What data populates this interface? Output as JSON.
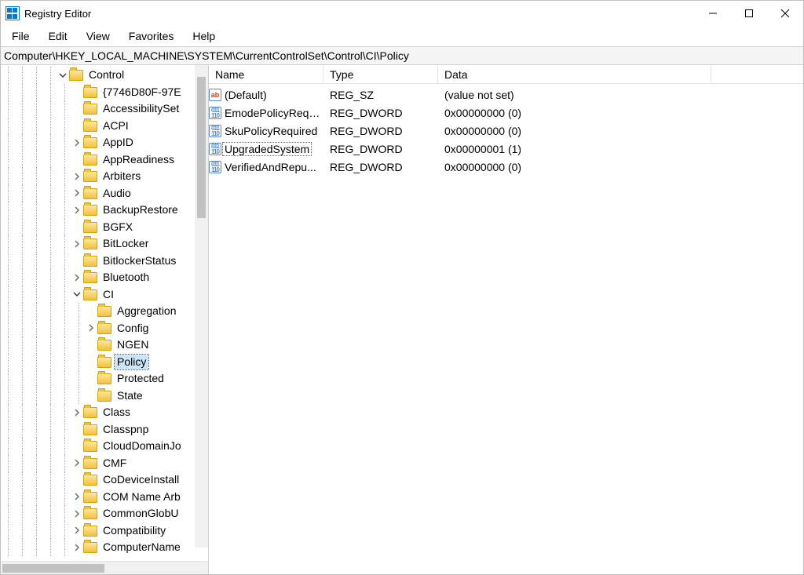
{
  "window": {
    "title": "Registry Editor"
  },
  "menu": {
    "file": "File",
    "edit": "Edit",
    "view": "View",
    "favorites": "Favorites",
    "help": "Help"
  },
  "address": "Computer\\HKEY_LOCAL_MACHINE\\SYSTEM\\CurrentControlSet\\Control\\CI\\Policy",
  "columns": {
    "name": "Name",
    "type": "Type",
    "data": "Data"
  },
  "values": [
    {
      "name": "(Default)",
      "type": "REG_SZ",
      "data": "(value not set)",
      "icon": "str",
      "highlighted": false
    },
    {
      "name": "EmodePolicyRequ...",
      "type": "REG_DWORD",
      "data": "0x00000000 (0)",
      "icon": "bin",
      "highlighted": false
    },
    {
      "name": "SkuPolicyRequired",
      "type": "REG_DWORD",
      "data": "0x00000000 (0)",
      "icon": "bin",
      "highlighted": false
    },
    {
      "name": "UpgradedSystem",
      "type": "REG_DWORD",
      "data": "0x00000001 (1)",
      "icon": "bin",
      "highlighted": true
    },
    {
      "name": "VerifiedAndRepu...",
      "type": "REG_DWORD",
      "data": "0x00000000 (0)",
      "icon": "bin",
      "highlighted": false
    }
  ],
  "tree": [
    {
      "depth": 4,
      "exp": "open",
      "label": "Control",
      "selected": false
    },
    {
      "depth": 5,
      "exp": "none",
      "label": "{7746D80F-97E",
      "selected": false
    },
    {
      "depth": 5,
      "exp": "none",
      "label": "AccessibilitySet",
      "selected": false
    },
    {
      "depth": 5,
      "exp": "none",
      "label": "ACPI",
      "selected": false
    },
    {
      "depth": 5,
      "exp": "closed",
      "label": "AppID",
      "selected": false
    },
    {
      "depth": 5,
      "exp": "none",
      "label": "AppReadiness",
      "selected": false
    },
    {
      "depth": 5,
      "exp": "closed",
      "label": "Arbiters",
      "selected": false
    },
    {
      "depth": 5,
      "exp": "closed",
      "label": "Audio",
      "selected": false
    },
    {
      "depth": 5,
      "exp": "closed",
      "label": "BackupRestore",
      "selected": false
    },
    {
      "depth": 5,
      "exp": "none",
      "label": "BGFX",
      "selected": false
    },
    {
      "depth": 5,
      "exp": "closed",
      "label": "BitLocker",
      "selected": false
    },
    {
      "depth": 5,
      "exp": "none",
      "label": "BitlockerStatus",
      "selected": false
    },
    {
      "depth": 5,
      "exp": "closed",
      "label": "Bluetooth",
      "selected": false
    },
    {
      "depth": 5,
      "exp": "open",
      "label": "CI",
      "selected": false
    },
    {
      "depth": 6,
      "exp": "none",
      "label": "Aggregation",
      "selected": false
    },
    {
      "depth": 6,
      "exp": "closed",
      "label": "Config",
      "selected": false
    },
    {
      "depth": 6,
      "exp": "none",
      "label": "NGEN",
      "selected": false
    },
    {
      "depth": 6,
      "exp": "none",
      "label": "Policy",
      "selected": true
    },
    {
      "depth": 6,
      "exp": "none",
      "label": "Protected",
      "selected": false
    },
    {
      "depth": 6,
      "exp": "none",
      "label": "State",
      "selected": false
    },
    {
      "depth": 5,
      "exp": "closed",
      "label": "Class",
      "selected": false
    },
    {
      "depth": 5,
      "exp": "none",
      "label": "Classpnp",
      "selected": false
    },
    {
      "depth": 5,
      "exp": "none",
      "label": "CloudDomainJo",
      "selected": false
    },
    {
      "depth": 5,
      "exp": "closed",
      "label": "CMF",
      "selected": false
    },
    {
      "depth": 5,
      "exp": "none",
      "label": "CoDeviceInstall",
      "selected": false
    },
    {
      "depth": 5,
      "exp": "closed",
      "label": "COM Name Arb",
      "selected": false
    },
    {
      "depth": 5,
      "exp": "closed",
      "label": "CommonGlobU",
      "selected": false
    },
    {
      "depth": 5,
      "exp": "closed",
      "label": "Compatibility",
      "selected": false
    },
    {
      "depth": 5,
      "exp": "closed",
      "label": "ComputerName",
      "selected": false
    }
  ]
}
